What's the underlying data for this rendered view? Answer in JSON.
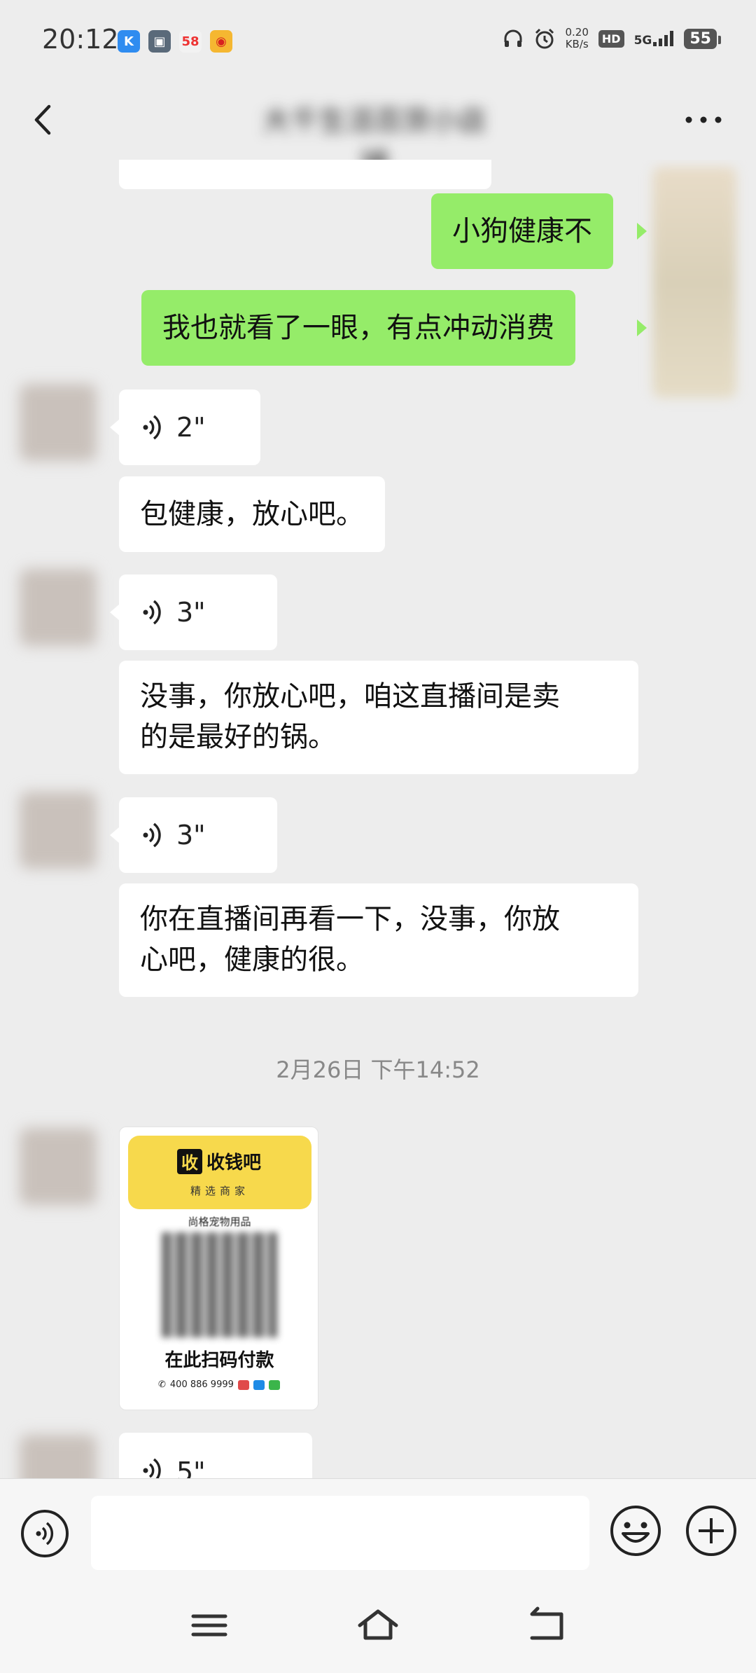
{
  "status_bar": {
    "time": "20:12",
    "apps": [
      {
        "icon": "k-app-icon",
        "label": "K",
        "color": "#2f8cf0"
      },
      {
        "icon": "box-app-icon",
        "label": "▣",
        "color": "#5a6a7a"
      },
      {
        "icon": "58-app-icon",
        "label": "58",
        "color": "#f2f2f2"
      },
      {
        "icon": "weibo-icon",
        "label": "◉",
        "color": "#f5b731"
      }
    ],
    "net_speed_value": "0.20",
    "net_speed_unit": "KB/s",
    "hd": "HD",
    "network": "5G",
    "battery": "55"
  },
  "header": {
    "title": "大千生活百货小店铺"
  },
  "messages": [
    {
      "type": "text",
      "side": "out",
      "text": "小狗健康不"
    },
    {
      "type": "text",
      "side": "out",
      "text": "我也就看了一眼，有点冲动消费"
    },
    {
      "type": "voice",
      "side": "in",
      "duration": "2\""
    },
    {
      "type": "text",
      "side": "in",
      "text": "包健康，放心吧。"
    },
    {
      "type": "voice",
      "side": "in",
      "duration": "3\""
    },
    {
      "type": "text",
      "side": "in",
      "line1": "没事，你放心吧，咱这直播间是卖",
      "line2": "的是最好的锅。"
    },
    {
      "type": "voice",
      "side": "in",
      "duration": "3\""
    },
    {
      "type": "text",
      "side": "in",
      "line1": "你在直播间再看一下，没事，你放",
      "line2": "心吧，健康的很。"
    },
    {
      "type": "voice",
      "side": "in",
      "duration": "5\""
    }
  ],
  "timestamp": "2月26日 下午14:52",
  "pay_card": {
    "logo_char": "收",
    "brand": "收钱吧",
    "subtitle": "精选商家",
    "store": "尚格宠物用品",
    "scan_text": "在此扫码付款",
    "phone": "400 886 9999"
  },
  "colors": {
    "background": "#ededed",
    "outgoing_bubble": "#95ec69",
    "incoming_bubble": "#ffffff",
    "card_yellow": "#f7d94c"
  }
}
